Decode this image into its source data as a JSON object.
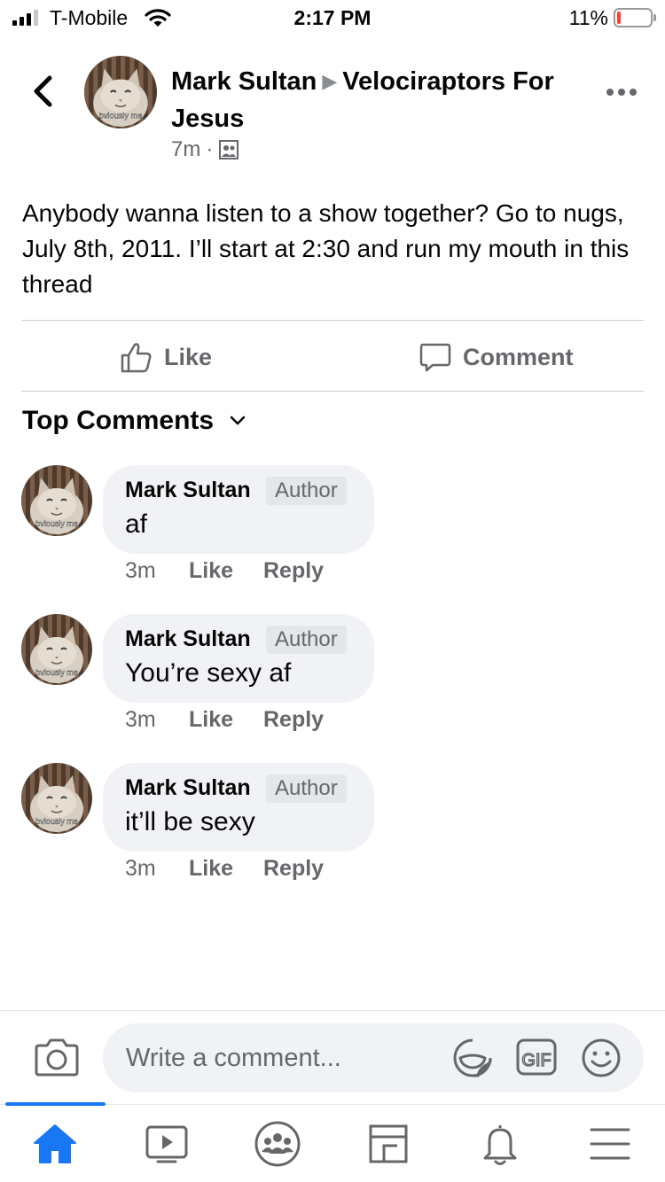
{
  "status_bar": {
    "carrier": "T-Mobile",
    "time": "2:17 PM",
    "battery_percent": "11%",
    "battery_level": 0.11,
    "battery_color": "#ff3b30"
  },
  "post": {
    "author": "Mark Sultan",
    "group": "Velociraptors For Jesus",
    "arrow_icon": "triangle-right-icon",
    "time": "7m",
    "audience_icon": "group-privacy-icon",
    "avatar_caption": "bviously me",
    "body": "Anybody wanna listen to a show together? Go to nugs, July 8th, 2011. I’ll start at 2:30 and run my mouth in this thread"
  },
  "actions": {
    "like_label": "Like",
    "comment_label": "Comment"
  },
  "comments_header": {
    "label": "Top Comments"
  },
  "comments": [
    {
      "author": "Mark Sultan",
      "badge": "Author",
      "text": "af",
      "time": "3m",
      "like": "Like",
      "reply": "Reply",
      "avatar_caption": "bviously me"
    },
    {
      "author": "Mark Sultan",
      "badge": "Author",
      "text": "You’re sexy af",
      "time": "3m",
      "like": "Like",
      "reply": "Reply",
      "avatar_caption": "bviously me"
    },
    {
      "author": "Mark Sultan",
      "badge": "Author",
      "text": "it’ll be sexy",
      "time": "3m",
      "like": "Like",
      "reply": "Reply",
      "avatar_caption": "bviously me"
    }
  ],
  "composer": {
    "placeholder": "Write a comment...",
    "gif_label": "GIF"
  },
  "tab_bar": {
    "items": [
      "home-icon",
      "watch-icon",
      "groups-icon",
      "pages-icon",
      "notifications-icon",
      "menu-icon"
    ],
    "active_color": "#1877f2"
  },
  "colors": {
    "accent": "#1877f2",
    "secondary_text": "#65676b",
    "bubble": "#f0f2f5"
  }
}
